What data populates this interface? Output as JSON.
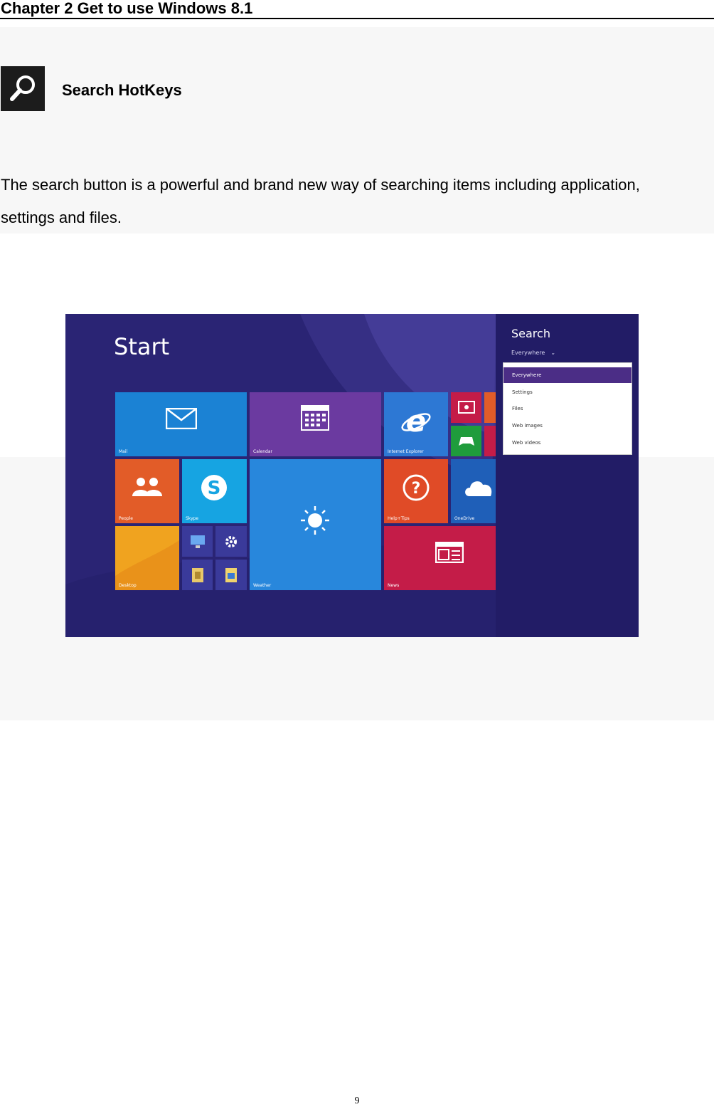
{
  "header": {
    "chapter_title": "Chapter 2 Get to use Windows 8.1"
  },
  "section": {
    "icon": "search-icon",
    "title": "Search HotKeys",
    "body": "The search button is a powerful and brand new way of searching items including application, settings and files."
  },
  "screenshot": {
    "start_label": "Start",
    "tiles": [
      {
        "label": "Mail",
        "icon": "mail-icon",
        "color": "#1b82d4"
      },
      {
        "label": "Calendar",
        "icon": "calendar-icon",
        "color": "#6b3aa0"
      },
      {
        "label": "Internet Explorer",
        "icon": "internet-explorer-icon",
        "color": "#2d78d4"
      },
      {
        "label": "People",
        "icon": "people-icon",
        "color": "#e25c28"
      },
      {
        "label": "Skype",
        "icon": "skype-icon",
        "color": "#16a4e2"
      },
      {
        "label": "Weather",
        "icon": "weather-sun-icon",
        "color": "#2887dc"
      },
      {
        "label": "Help+Tips",
        "icon": "help-icon",
        "color": "#e04b27"
      },
      {
        "label": "OneDrive",
        "icon": "cloud-icon",
        "color": "#1f5fb8"
      },
      {
        "label": "Desktop",
        "icon": "desktop-icon",
        "color": "#f0a31f"
      },
      {
        "label": "News",
        "icon": "news-icon",
        "color": "#c41c48"
      }
    ],
    "search_panel": {
      "title": "Search",
      "scope": "Everywhere",
      "options": [
        "Everywhere",
        "Settings",
        "Files",
        "Web images",
        "Web videos"
      ],
      "selected": "Everywhere"
    }
  },
  "footer": {
    "page_number": "9"
  }
}
